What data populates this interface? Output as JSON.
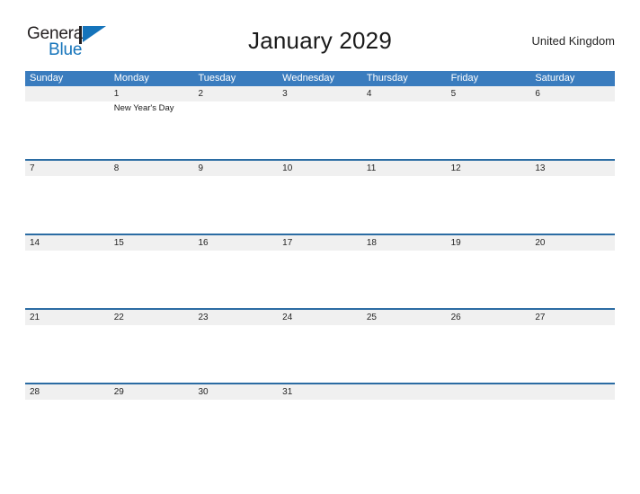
{
  "brand": {
    "name_top": "General",
    "name_bottom": "Blue",
    "mark": "flag-triangle-icon",
    "color_dark": "#231f20",
    "color_blue": "#1574bb"
  },
  "header": {
    "month_title": "January 2029",
    "country": "United Kingdom"
  },
  "colors": {
    "weekday_header_bg": "#3a7cbe",
    "weekday_header_text": "#ffffff",
    "week_separator": "#2b6ca3",
    "daynum_band_bg": "#f0f0f0",
    "daynum_text": "#262626",
    "page_bg": "#ffffff"
  },
  "calendar": {
    "weekdays": [
      "Sunday",
      "Monday",
      "Tuesday",
      "Wednesday",
      "Thursday",
      "Friday",
      "Saturday"
    ],
    "weeks": [
      {
        "days": [
          {
            "number": "",
            "events": []
          },
          {
            "number": "1",
            "events": [
              "New Year's Day"
            ]
          },
          {
            "number": "2",
            "events": []
          },
          {
            "number": "3",
            "events": []
          },
          {
            "number": "4",
            "events": []
          },
          {
            "number": "5",
            "events": []
          },
          {
            "number": "6",
            "events": []
          }
        ]
      },
      {
        "days": [
          {
            "number": "7",
            "events": []
          },
          {
            "number": "8",
            "events": []
          },
          {
            "number": "9",
            "events": []
          },
          {
            "number": "10",
            "events": []
          },
          {
            "number": "11",
            "events": []
          },
          {
            "number": "12",
            "events": []
          },
          {
            "number": "13",
            "events": []
          }
        ]
      },
      {
        "days": [
          {
            "number": "14",
            "events": []
          },
          {
            "number": "15",
            "events": []
          },
          {
            "number": "16",
            "events": []
          },
          {
            "number": "17",
            "events": []
          },
          {
            "number": "18",
            "events": []
          },
          {
            "number": "19",
            "events": []
          },
          {
            "number": "20",
            "events": []
          }
        ]
      },
      {
        "days": [
          {
            "number": "21",
            "events": []
          },
          {
            "number": "22",
            "events": []
          },
          {
            "number": "23",
            "events": []
          },
          {
            "number": "24",
            "events": []
          },
          {
            "number": "25",
            "events": []
          },
          {
            "number": "26",
            "events": []
          },
          {
            "number": "27",
            "events": []
          }
        ]
      },
      {
        "days": [
          {
            "number": "28",
            "events": []
          },
          {
            "number": "29",
            "events": []
          },
          {
            "number": "30",
            "events": []
          },
          {
            "number": "31",
            "events": []
          },
          {
            "number": "",
            "events": []
          },
          {
            "number": "",
            "events": []
          },
          {
            "number": "",
            "events": []
          }
        ]
      }
    ]
  }
}
